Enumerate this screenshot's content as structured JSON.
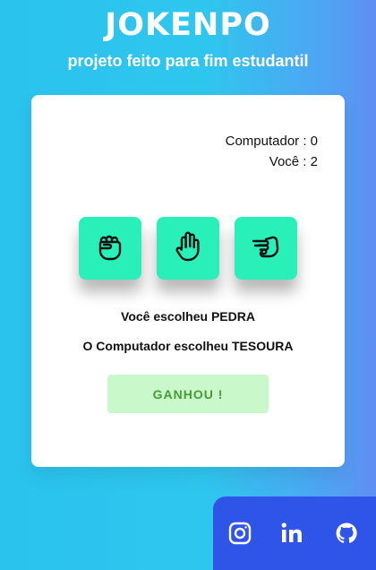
{
  "header": {
    "title": "JOKENPO",
    "subtitle": "projeto feito para fim estudantil"
  },
  "score": {
    "computer": "Computador : 0",
    "player": "Você : 2"
  },
  "choices": [
    {
      "icon": "fist-icon",
      "label": "pedra"
    },
    {
      "icon": "open-hand-icon",
      "label": "papel"
    },
    {
      "icon": "scissors-hand-icon",
      "label": "tesoura"
    }
  ],
  "result": {
    "player_choice": "Você escolheu PEDRA",
    "computer_choice": "O Computador escolheu TESOURA",
    "outcome": "GANHOU !"
  },
  "social": [
    {
      "icon": "instagram-icon"
    },
    {
      "icon": "linkedin-icon"
    },
    {
      "icon": "github-icon"
    }
  ],
  "colors": {
    "accent": "#28f0b8",
    "outcome_bg": "#c9f8cb",
    "outcome_text": "#4a9a3a",
    "social_bar": "#2f55e8"
  }
}
